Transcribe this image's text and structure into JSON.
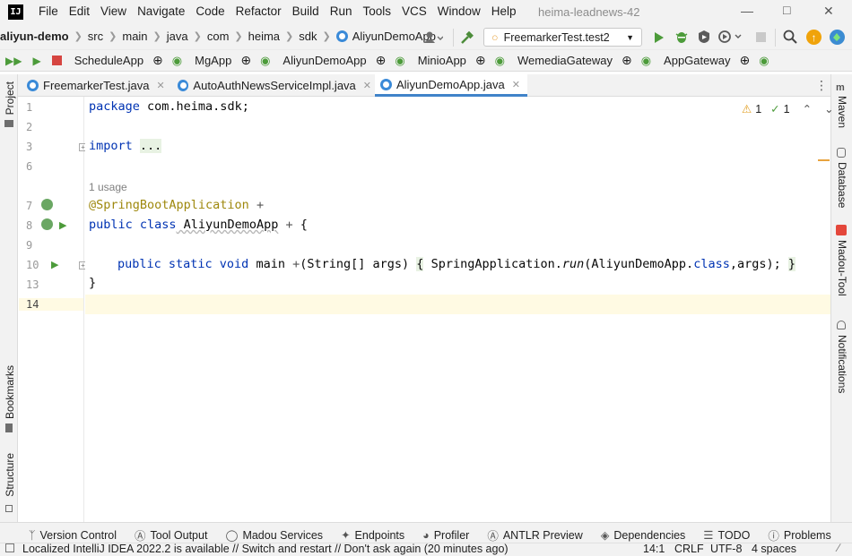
{
  "menubar": {
    "items": [
      "File",
      "Edit",
      "View",
      "Navigate",
      "Code",
      "Refactor",
      "Build",
      "Run",
      "Tools",
      "VCS",
      "Window",
      "Help"
    ],
    "project_title": "heima-leadnews-42"
  },
  "navbar": {
    "crumbs": [
      "aliyun-demo",
      "src",
      "main",
      "java",
      "com",
      "heima",
      "sdk",
      "AliyunDemoApp"
    ],
    "run_config": "FreemarkerTest.test2"
  },
  "services": {
    "items": [
      "ScheduleApp",
      "MgApp",
      "AliyunDemoApp",
      "MinioApp",
      "WemediaGateway",
      "AppGateway"
    ]
  },
  "tabs": [
    {
      "label": "FreemarkerTest.java"
    },
    {
      "label": "AutoAuthNewsServiceImpl.java"
    },
    {
      "label": "AliyunDemoApp.java"
    }
  ],
  "left_strip": {
    "project": "Project",
    "bookmarks": "Bookmarks",
    "structure": "Structure"
  },
  "right_strip": {
    "maven": "Maven",
    "database": "Database",
    "madou": "Madou-Tool",
    "notifications": "Notifications"
  },
  "editor": {
    "line_numbers": [
      "1",
      "2",
      "3",
      "6",
      "7",
      "8",
      "9",
      "10",
      "13",
      "14"
    ],
    "usage": "1 usage",
    "warnings": "1",
    "weak_warnings": "1",
    "code": {
      "l1_kw": "package",
      "l1_rest": " com.heima.sdk;",
      "l3_kw": "import",
      "l3_fold": "...",
      "l7_ann": "@SpringBootApplication",
      "l8_kw": "public class",
      "l8_name": " AliyunDemoApp",
      "l8_rest": " {",
      "l10_kw": "public static void",
      "l10_name": " main",
      "l10_params": "(String[] args)",
      "l10_body_open": "{",
      "l10_call1": " SpringApplication.",
      "l10_run": "run",
      "l10_call2": "(AliyunDemoApp.",
      "l10_class": "class",
      "l10_call3": ",args); ",
      "l10_body_close": "}",
      "l13": "}"
    }
  },
  "toolwindows": [
    "Version Control",
    "Tool Output",
    "Madou Services",
    "Endpoints",
    "Profiler",
    "ANTLR Preview",
    "Dependencies",
    "TODO",
    "Problems"
  ],
  "status": {
    "message": "Localized IntelliJ IDEA 2022.2 is available // Switch and restart // Don't ask again (20 minutes ago)",
    "position": "14:1",
    "line_sep": "CRLF",
    "encoding": "UTF-8",
    "indent": "4 spaces"
  }
}
